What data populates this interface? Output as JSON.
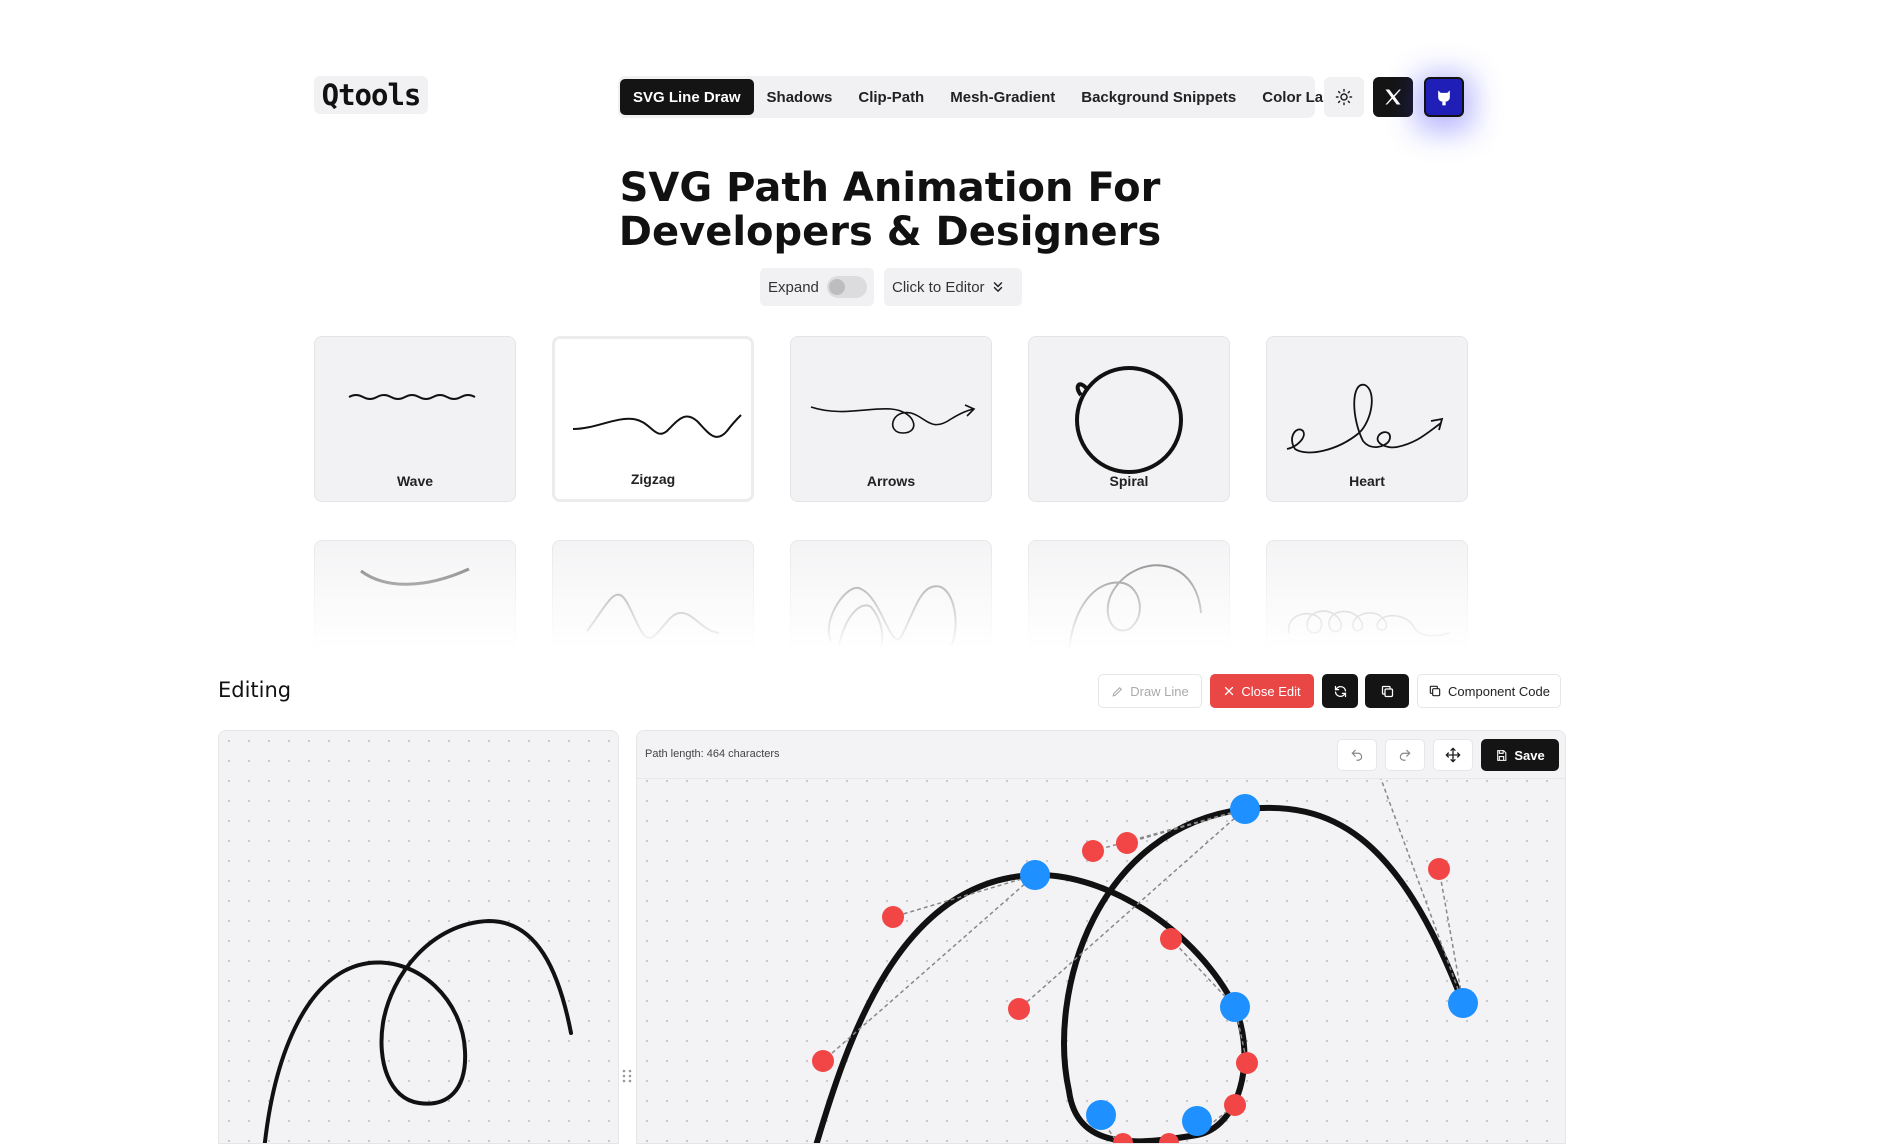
{
  "logo": {
    "text": "Qtools"
  },
  "nav": {
    "items": [
      "SVG Line Draw",
      "Shadows",
      "Clip-Path",
      "Mesh-Gradient",
      "Background Snippets",
      "Color Lab"
    ],
    "active_index": 0
  },
  "icons": {
    "theme": "sun-icon",
    "x": "x-logo-icon",
    "github": "github-icon"
  },
  "hero": {
    "title_line1": "SVG Path Animation For",
    "title_line2": "Developers & Designers"
  },
  "controls": {
    "expand_label": "Expand",
    "expand_on": false,
    "editor_label": "Click to Editor"
  },
  "presets": [
    {
      "label": "Wave"
    },
    {
      "label": "Zigzag",
      "selected": true
    },
    {
      "label": "Arrows"
    },
    {
      "label": "Spiral"
    },
    {
      "label": "Heart"
    }
  ],
  "editing": {
    "title": "Editing",
    "draw_line_label": "Draw Line",
    "close_edit_label": "Close Edit",
    "component_code_label": "Component Code",
    "path_length_text": "Path length: 464 characters",
    "save_label": "Save"
  },
  "colors": {
    "accent_dark": "#141414",
    "danger": "#e94646",
    "anchor_point": "#1e90ff",
    "control_point": "#f24646",
    "github_bg": "#1f1fb8"
  }
}
